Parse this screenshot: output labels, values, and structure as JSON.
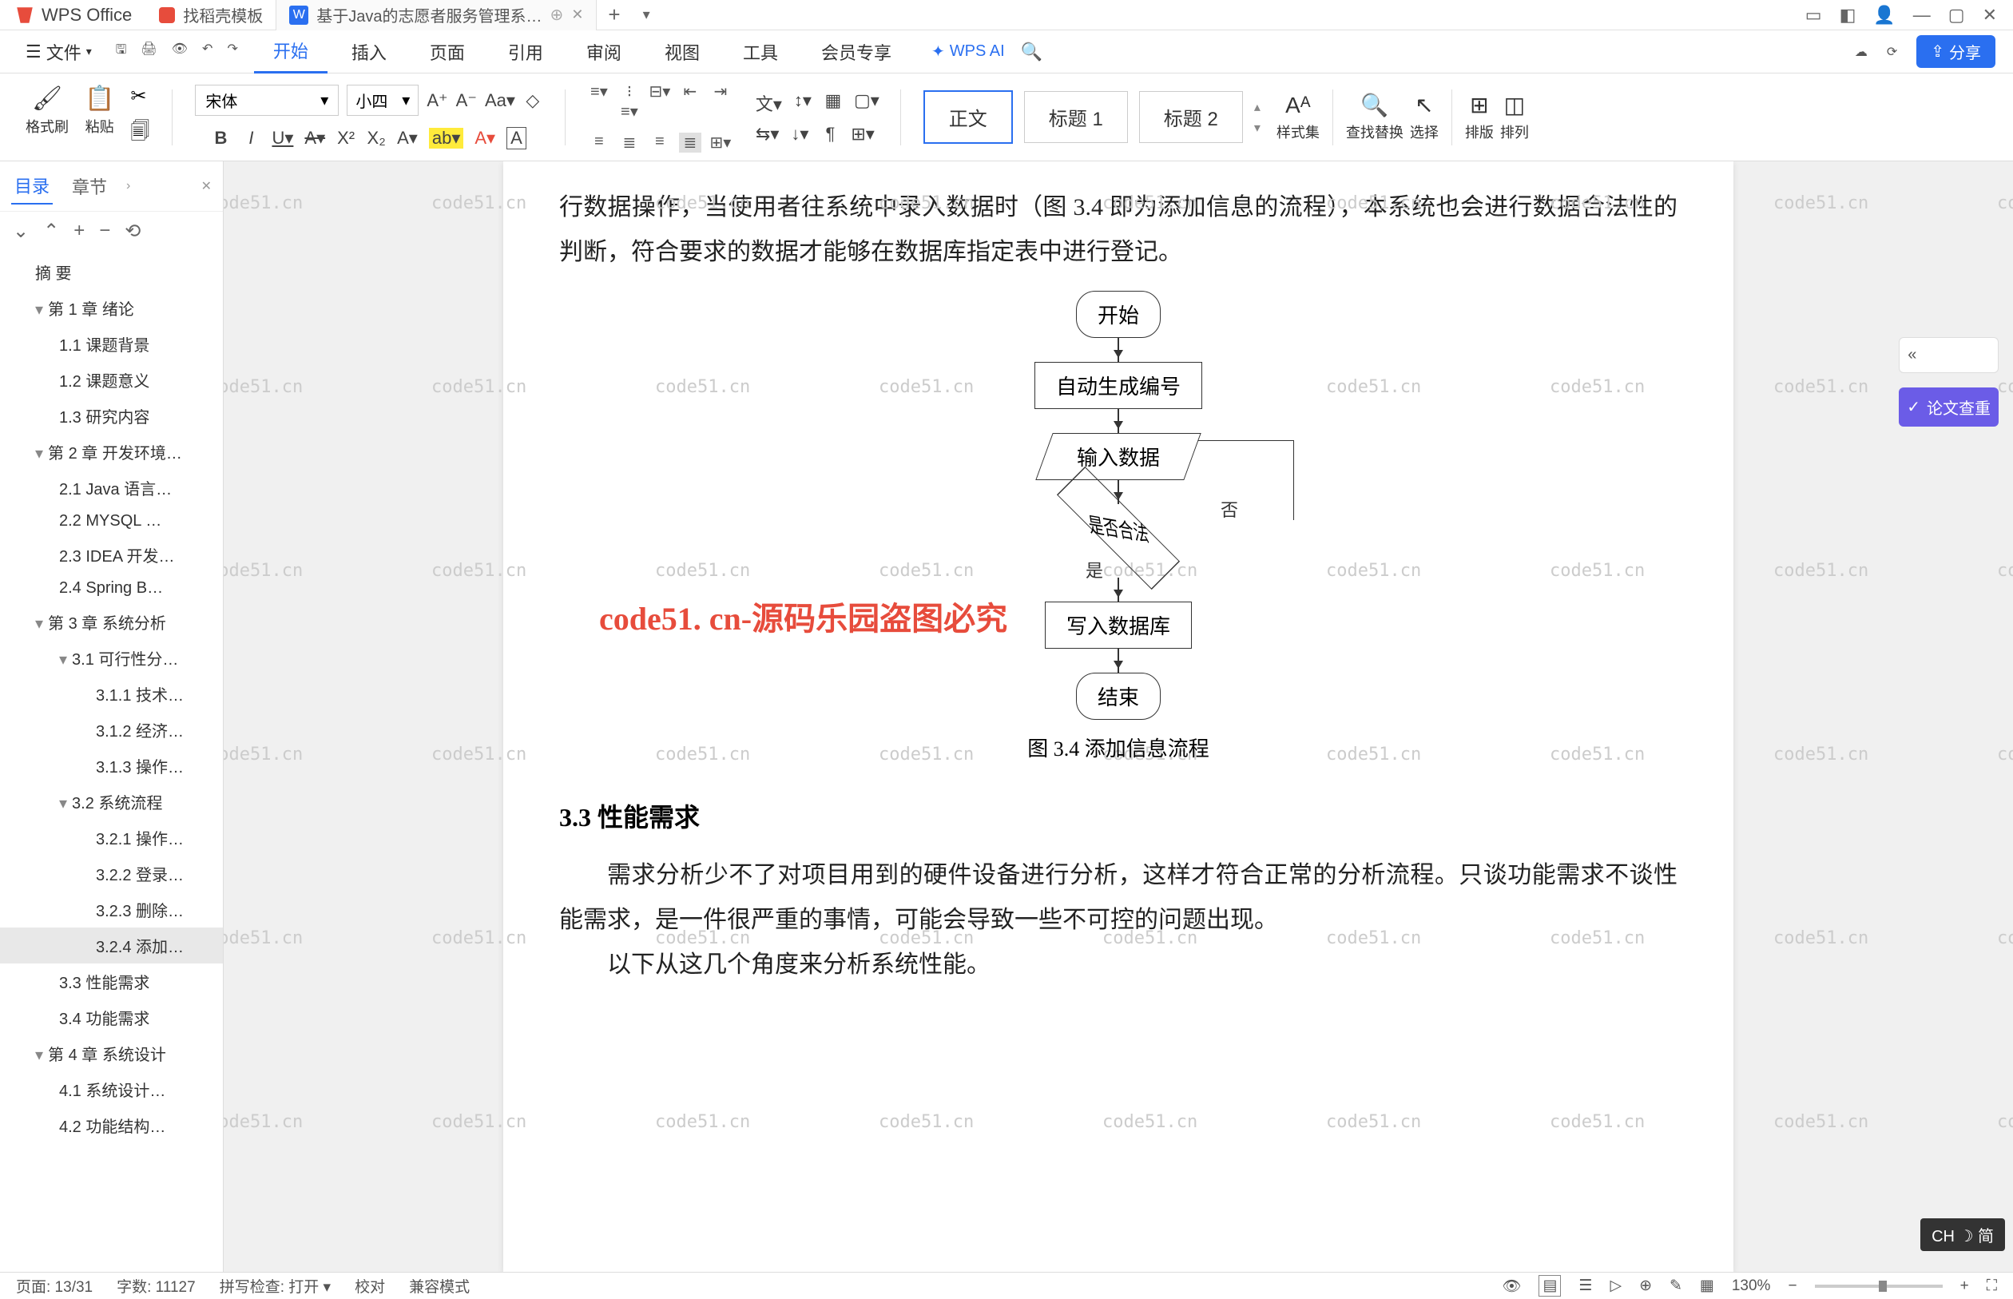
{
  "app": {
    "name": "WPS Office"
  },
  "tabs": [
    {
      "icon_color": "#e74c3c",
      "label": "找稻壳模板"
    },
    {
      "icon": "W",
      "icon_bg": "#2a6ff0",
      "label": "基于Java的志愿者服务管理系…",
      "active": true
    }
  ],
  "title_right_icons": [
    "layout-icon",
    "cube-icon",
    "avatar-icon",
    "minimize-icon",
    "maximize-icon",
    "close-icon"
  ],
  "menu": {
    "file": "文件",
    "items": [
      "开始",
      "插入",
      "页面",
      "引用",
      "审阅",
      "视图",
      "工具",
      "会员专享"
    ],
    "active": "开始",
    "ai": "WPS AI",
    "share": "分享"
  },
  "ribbon": {
    "format_painter": "格式刷",
    "paste": "粘贴",
    "font_family": "宋体",
    "font_size": "小四",
    "styles": {
      "body": "正文",
      "h1": "标题 1",
      "h2": "标题 2"
    },
    "style_set": "样式集",
    "find_replace": "查找替换",
    "select": "选择",
    "arrange": "排版",
    "align": "排列"
  },
  "outline": {
    "tab_toc": "目录",
    "tab_chapter": "章节",
    "items": [
      {
        "t": "摘  要",
        "l": 1
      },
      {
        "t": "第 1 章  绪论",
        "l": 1,
        "c": true
      },
      {
        "t": "1.1 课题背景",
        "l": 2
      },
      {
        "t": "1.2 课题意义",
        "l": 2
      },
      {
        "t": "1.3 研究内容",
        "l": 2
      },
      {
        "t": "第 2 章  开发环境…",
        "l": 1,
        "c": true
      },
      {
        "t": "2.1 Java 语言…",
        "l": 2
      },
      {
        "t": "2.2 MYSQL …",
        "l": 2
      },
      {
        "t": "2.3 IDEA 开发…",
        "l": 2
      },
      {
        "t": "2.4 Spring B…",
        "l": 2
      },
      {
        "t": "第 3 章  系统分析",
        "l": 1,
        "c": true
      },
      {
        "t": "3.1  可行性分…",
        "l": 2,
        "c": true
      },
      {
        "t": "3.1.1 技术…",
        "l": 4
      },
      {
        "t": "3.1.2 经济…",
        "l": 4
      },
      {
        "t": "3.1.3 操作…",
        "l": 4
      },
      {
        "t": "3.2  系统流程",
        "l": 2,
        "c": true
      },
      {
        "t": "3.2.1 操作…",
        "l": 4
      },
      {
        "t": "3.2.2 登录…",
        "l": 4
      },
      {
        "t": "3.2.3 删除…",
        "l": 4
      },
      {
        "t": "3.2.4 添加…",
        "l": 4,
        "sel": true
      },
      {
        "t": "3.3 性能需求",
        "l": 2
      },
      {
        "t": "3.4 功能需求",
        "l": 2
      },
      {
        "t": "第 4 章  系统设计",
        "l": 1,
        "c": true
      },
      {
        "t": "4.1 系统设计…",
        "l": 2
      },
      {
        "t": "4.2 功能结构…",
        "l": 2
      }
    ]
  },
  "doc": {
    "para1": "行数据操作，当使用者往系统中录入数据时（图 3.4 即为添加信息的流程），本系统也会进行数据合法性的判断，符合要求的数据才能够在数据库指定表中进行登记。",
    "flow": {
      "start": "开始",
      "gen_id": "自动生成编号",
      "input": "输入数据",
      "check": "是否合法",
      "no": "否",
      "yes": "是",
      "write": "写入数据库",
      "end": "结束",
      "caption": "图 3.4  添加信息流程"
    },
    "h33": "3.3   性能需求",
    "para2": "需求分析少不了对项目用到的硬件设备进行分析，这样才符合正常的分析流程。只谈功能需求不谈性能需求，是一件很严重的事情，可能会导致一些不可控的问题出现。",
    "para3": "以下从这几个角度来分析系统性能。"
  },
  "watermark_text": "code51.cn",
  "center_watermark": "code51. cn-源码乐园盗图必究",
  "right_float": {
    "collapse": "«",
    "check": "论文查重"
  },
  "status": {
    "page": "页面: 13/31",
    "words": "字数: 11127",
    "spell": "拼写检查: 打开",
    "proof": "校对",
    "compat": "兼容模式",
    "zoom": "130%"
  },
  "ime": "CH ☽ 简"
}
